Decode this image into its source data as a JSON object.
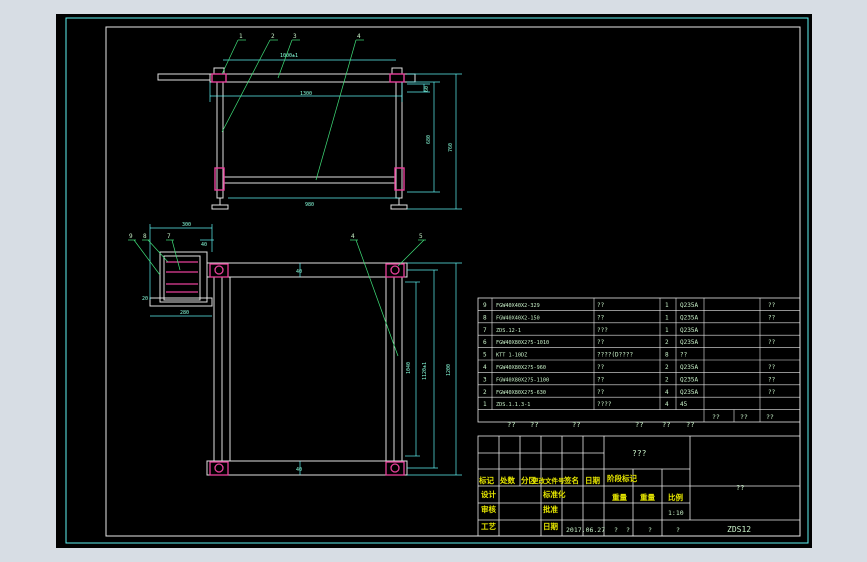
{
  "colors": {
    "background": "#d7dde4",
    "sheet": "#000000",
    "frame": "#5ef2f2",
    "part_line": "#e0e0e0",
    "leader": "#3fe07a",
    "dimension": "#5ef2f2",
    "highlight": "#e6409a",
    "header_text": "#e6e600"
  },
  "drawing": {
    "front_view": {
      "balloons": [
        "1",
        "2",
        "3",
        "4"
      ],
      "dims": {
        "top_span": "1000±1",
        "inner_width": "1300",
        "bottom_width": "980",
        "height_small": "60",
        "height_mid": "680",
        "height_total": "760"
      }
    },
    "top_view": {
      "balloons": [
        "9",
        "8",
        "7",
        "4",
        "5"
      ],
      "dims": {
        "side_width": "300",
        "side_gap": "40",
        "side_small": "20",
        "side_bottom": "280",
        "inner": "1040",
        "inner2": "1120±1",
        "total": "1200",
        "top_small": "40"
      }
    }
  },
  "bom": [
    {
      "no": "9",
      "code": "FGW40X40X2-329",
      "name": "??",
      "qty": "1",
      "mat": "Q235A",
      "remark": "??"
    },
    {
      "no": "8",
      "code": "FGW40X40X2-150",
      "name": "??",
      "qty": "1",
      "mat": "Q235A",
      "remark": "??"
    },
    {
      "no": "7",
      "code": "ZDS.12-1",
      "name": "???",
      "qty": "1",
      "mat": "Q235A",
      "remark": ""
    },
    {
      "no": "6",
      "code": "FGW40X80X2?5-1010",
      "name": "??",
      "qty": "2",
      "mat": "Q235A",
      "remark": "??"
    },
    {
      "no": "5",
      "code": "KTT 1-10DZ",
      "name": "????(D????",
      "qty": "8",
      "mat": "??",
      "remark": ""
    },
    {
      "no": "4",
      "code": "FGW40X80X2?5-960",
      "name": "??",
      "qty": "2",
      "mat": "Q235A",
      "remark": "??"
    },
    {
      "no": "3",
      "code": "FGW40X80X2?5-1100",
      "name": "??",
      "qty": "2",
      "mat": "Q235A",
      "remark": "??"
    },
    {
      "no": "2",
      "code": "FGW40X80X2?5-630",
      "name": "??",
      "qty": "4",
      "mat": "Q235A",
      "remark": "??"
    },
    {
      "no": "1",
      "code": "ZDS.1.1.3-1",
      "name": "????",
      "qty": "4",
      "mat": "45",
      "remark": ""
    }
  ],
  "bom_header": {
    "c1": "??",
    "c2": "??",
    "c3": "??"
  },
  "title_block": {
    "top_marks": [
      "??",
      "??",
      "??",
      "??",
      "??",
      "??"
    ],
    "drawing_name": "???",
    "right_title": "??",
    "header_row": [
      "标记",
      "处数",
      "分区",
      "更改文件号",
      "签名",
      "日期"
    ],
    "stage_labels": [
      "阶段标记",
      "重量",
      "比例"
    ],
    "roles": [
      "设计",
      "审核",
      "工艺"
    ],
    "roles_mid": [
      "标准化",
      "批准",
      "日期"
    ],
    "date": "2017.06.27",
    "scale": "1:10",
    "sheet": [
      "?",
      "?",
      "?",
      "?"
    ],
    "code": "ZDS12"
  }
}
